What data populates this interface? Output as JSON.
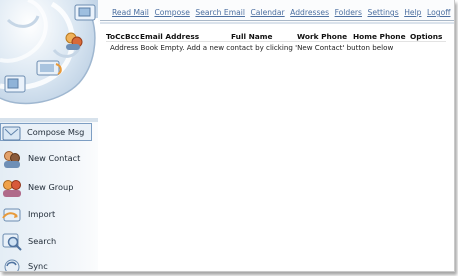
{
  "nav": {
    "links": [
      "Read Mail",
      "Compose",
      "Search Email",
      "Calendar",
      "Addresses",
      "Folders",
      "Settings",
      "Help",
      "Logoff"
    ]
  },
  "sidebar": {
    "items": [
      {
        "label": "Compose Msg",
        "icon": "compose-icon"
      },
      {
        "label": "New Contact",
        "icon": "contact-icon"
      },
      {
        "label": "New Group",
        "icon": "group-icon"
      },
      {
        "label": "Import",
        "icon": "import-icon"
      },
      {
        "label": "Search",
        "icon": "search-icon"
      },
      {
        "label": "Sync",
        "icon": "sync-icon"
      }
    ]
  },
  "table": {
    "headers": {
      "tocc": "ToCcBcc",
      "email": "Email Address",
      "fullname": "Full Name",
      "work": "Work Phone",
      "home": "Home Phone",
      "options": "Options"
    },
    "empty_message": "Address Book Empty. Add a new contact by clicking 'New Contact' button below"
  },
  "colors": {
    "link": "#4c6fa0",
    "accent": "#7d9ec3"
  }
}
